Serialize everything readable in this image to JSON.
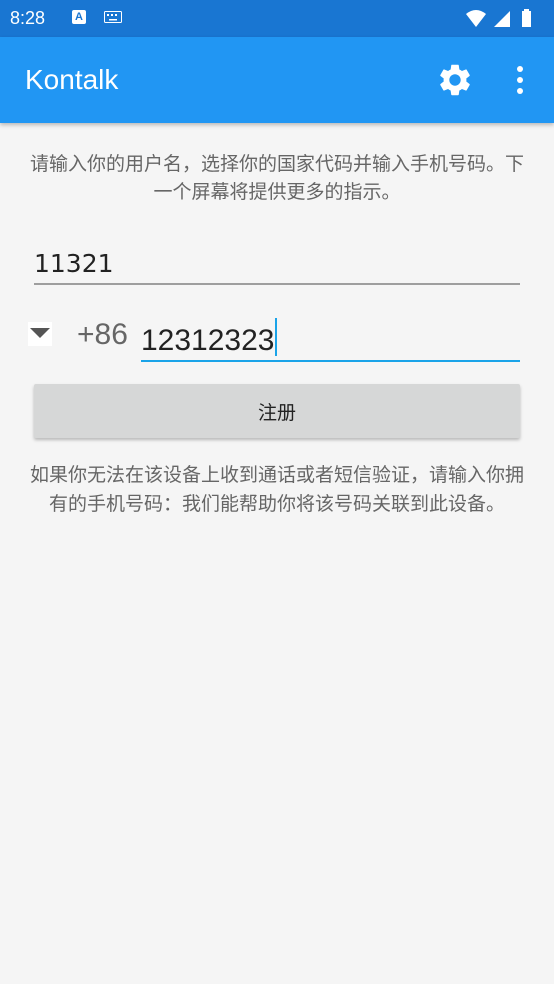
{
  "status_bar": {
    "time": "8:28",
    "icons": [
      "a-notification-icon",
      "keyboard-icon",
      "wifi-icon",
      "signal-icon",
      "battery-icon"
    ]
  },
  "app_bar": {
    "title": "Kontalk",
    "actions": [
      "settings-icon",
      "more-vert-icon"
    ]
  },
  "form": {
    "intro": "请输入你的用户名，选择你的国家代码并输入手机号码。下一个屏幕将提供更多的指示。",
    "username_value": "11321",
    "country_code": "+86",
    "phone_value": "12312323",
    "register_label": "注册",
    "help": "如果你无法在该设备上收到通话或者短信验证，请输入你拥有的手机号码：我们能帮助你将该号码关联到此设备。"
  },
  "colors": {
    "status_bar": "#1976d2",
    "app_bar": "#2196f3",
    "accent": "#1aa3e8",
    "button": "#d6d7d7"
  }
}
